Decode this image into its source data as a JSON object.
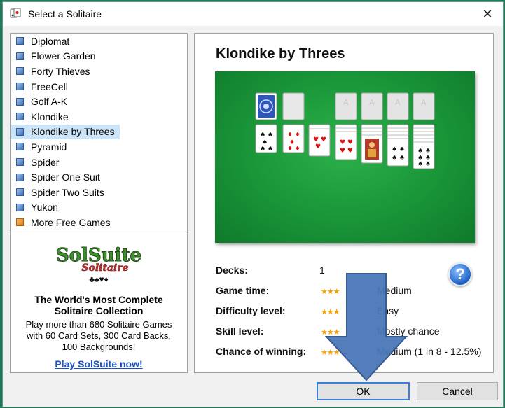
{
  "window": {
    "title": "Select a Solitaire",
    "close_glyph": "✕"
  },
  "game_list": {
    "items": [
      {
        "label": "Diplomat",
        "icon": "card-icon"
      },
      {
        "label": "Flower Garden",
        "icon": "card-icon"
      },
      {
        "label": "Forty Thieves",
        "icon": "card-icon"
      },
      {
        "label": "FreeCell",
        "icon": "card-icon"
      },
      {
        "label": "Golf A-K",
        "icon": "card-icon"
      },
      {
        "label": "Klondike",
        "icon": "card-icon"
      },
      {
        "label": "Klondike by Threes",
        "icon": "card-icon",
        "selected": true
      },
      {
        "label": "Pyramid",
        "icon": "card-icon"
      },
      {
        "label": "Spider",
        "icon": "card-icon"
      },
      {
        "label": "Spider One Suit",
        "icon": "card-icon"
      },
      {
        "label": "Spider Two Suits",
        "icon": "card-icon"
      },
      {
        "label": "Yukon",
        "icon": "card-icon"
      },
      {
        "label": "More Free Games",
        "icon": "orange-card-icon"
      }
    ]
  },
  "promo": {
    "logo_text": "SolSuite",
    "logo_subtext": "Solitaire",
    "heading": "The World's Most Complete Solitaire Collection",
    "body": "Play more than 680 Solitaire Games with 60 Card Sets, 300 Card Backs, 100 Backgrounds!",
    "link": "Play SolSuite now!"
  },
  "details": {
    "title": "Klondike by Threes",
    "decks_label": "Decks:",
    "decks_value": "1",
    "rows": [
      {
        "label": "Game time:",
        "stars": "★★★",
        "value": "Medium"
      },
      {
        "label": "Difficulty level:",
        "stars": "★★★",
        "value": "Easy"
      },
      {
        "label": "Skill level:",
        "stars": "★★★",
        "value": "Mostly chance"
      },
      {
        "label": "Chance of winning:",
        "stars": "★★★",
        "value": "Medium (1 in 8  -  12.5%)"
      }
    ],
    "help_glyph": "?"
  },
  "buttons": {
    "ok": "OK",
    "cancel": "Cancel"
  },
  "colors": {
    "felt": "#1c9a3b",
    "arrow": "#4a78b8",
    "selection": "#cce4f7"
  }
}
